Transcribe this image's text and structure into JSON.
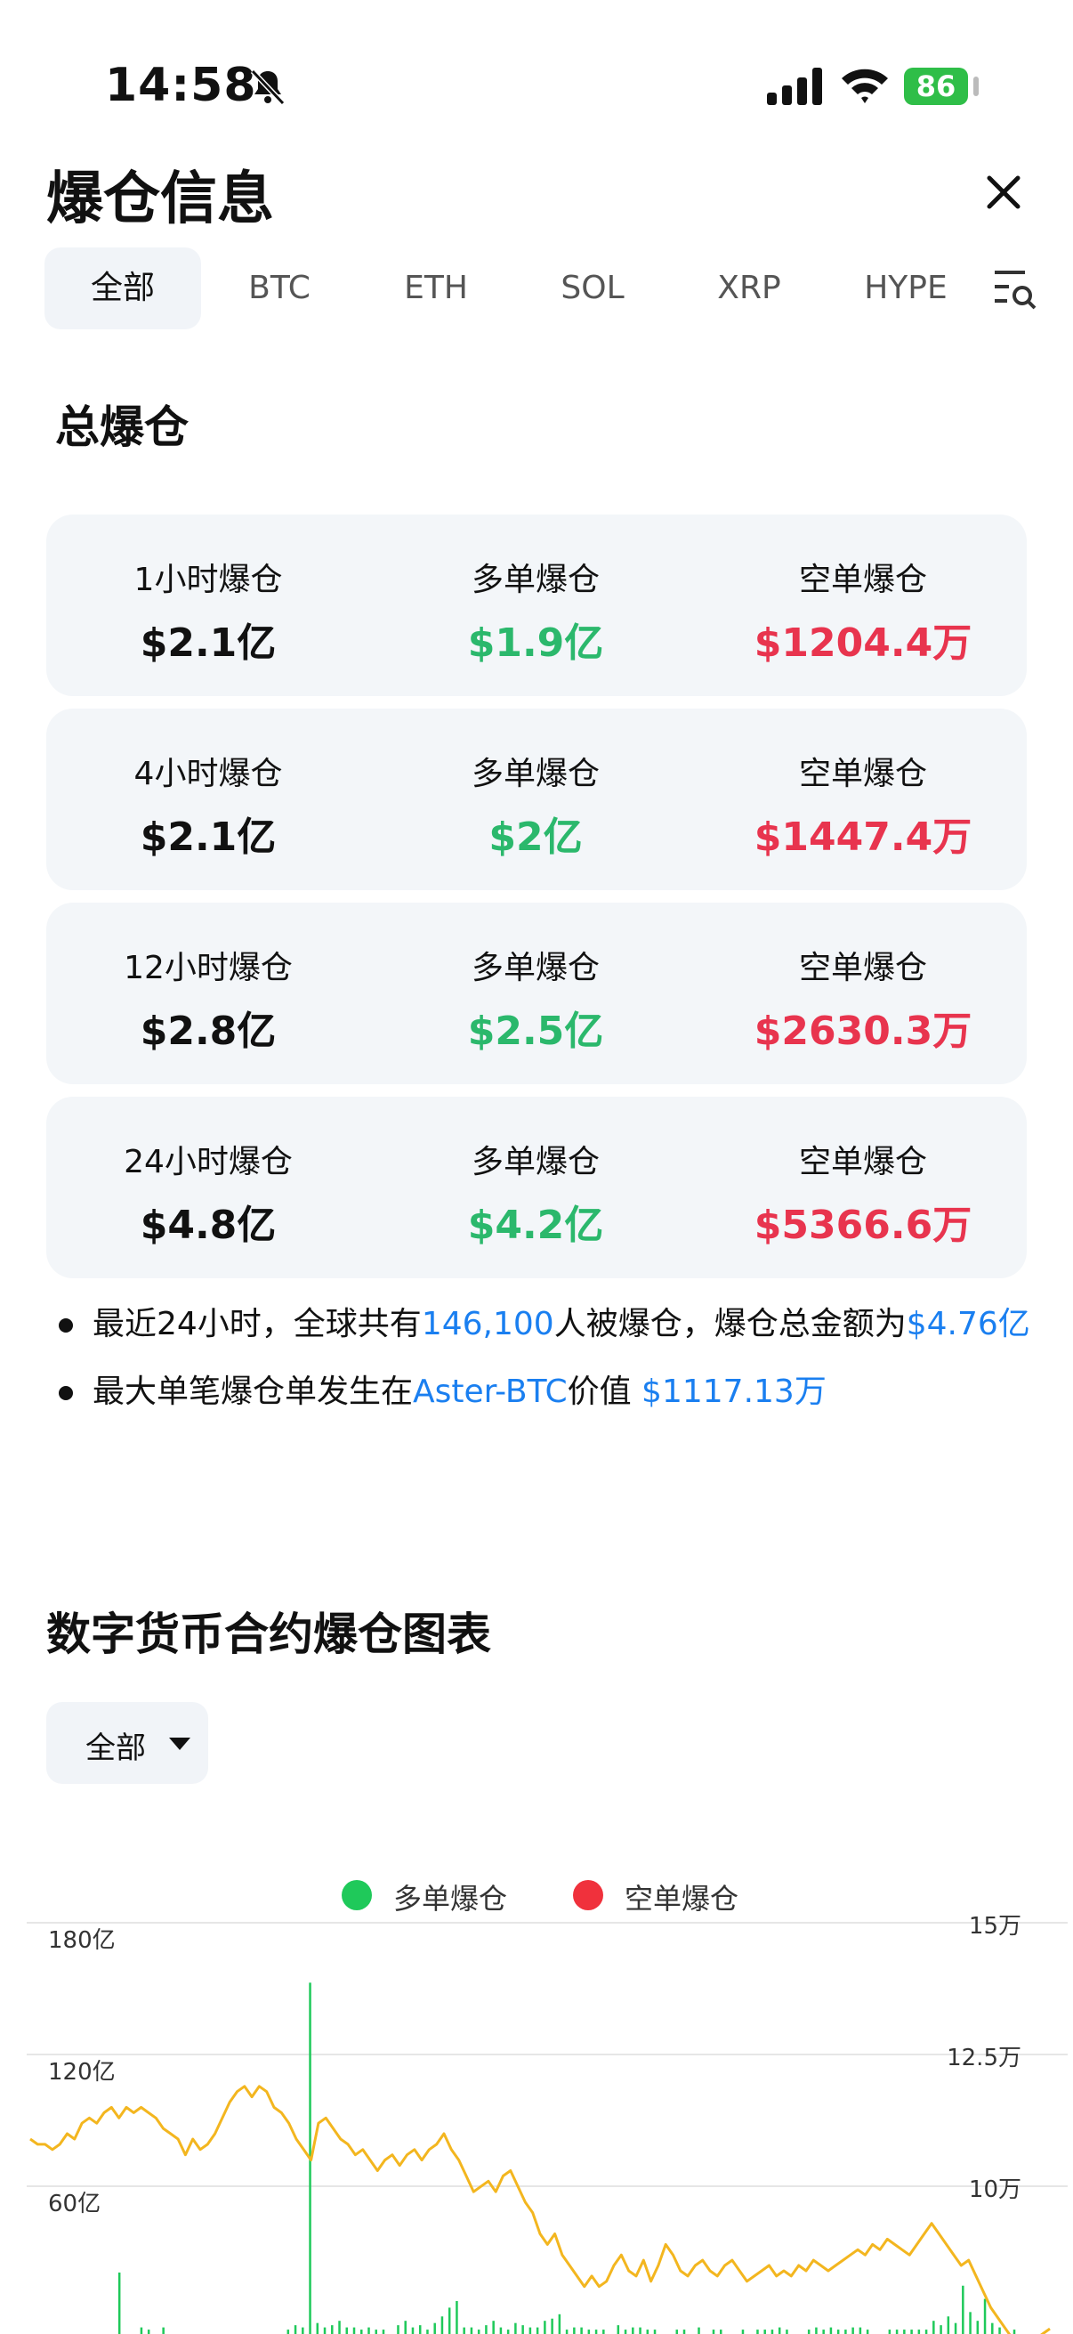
{
  "status_bar": {
    "time": "14:58",
    "battery": "86"
  },
  "header": {
    "title": "爆仓信息"
  },
  "tabs": [
    "全部",
    "BTC",
    "ETH",
    "SOL",
    "XRP",
    "HYPE"
  ],
  "summary": {
    "title": "总爆仓",
    "rows": [
      {
        "period": "1小时爆仓",
        "total": "$2.1亿",
        "long_label": "多单爆仓",
        "long": "$1.9亿",
        "short_label": "空单爆仓",
        "short": "$1204.4万"
      },
      {
        "period": "4小时爆仓",
        "total": "$2.1亿",
        "long_label": "多单爆仓",
        "long": "$2亿",
        "short_label": "空单爆仓",
        "short": "$1447.4万"
      },
      {
        "period": "12小时爆仓",
        "total": "$2.8亿",
        "long_label": "多单爆仓",
        "long": "$2.5亿",
        "short_label": "空单爆仓",
        "short": "$2630.3万"
      },
      {
        "period": "24小时爆仓",
        "total": "$4.8亿",
        "long_label": "多单爆仓",
        "long": "$4.2亿",
        "short_label": "空单爆仓",
        "short": "$5366.6万"
      }
    ]
  },
  "notes": {
    "n1_prefix": "最近24小时，全球共有",
    "n1_people": "146,100",
    "n1_mid": "人被爆仓，爆仓总金额为",
    "n1_amount": "$4.76亿",
    "n2_prefix": "最大单笔爆仓单发生在",
    "n2_pair": "Aster-BTC",
    "n2_mid": "价值 ",
    "n2_amount": "$1117.13万"
  },
  "chart_section": {
    "title": "数字货币合约爆仓图表",
    "filter_value": "全部"
  },
  "chart_data": {
    "type": "bar",
    "legend": [
      {
        "name": "多单爆仓",
        "color": "#1fc95a"
      },
      {
        "name": "空单爆仓",
        "color": "#f0313c"
      }
    ],
    "left_axis": {
      "ticks": [
        "180亿",
        "120亿",
        "60亿"
      ],
      "values": [
        180,
        120,
        60
      ],
      "unit": "亿"
    },
    "right_axis": {
      "ticks": [
        "15万",
        "12.5万",
        "10万"
      ],
      "values": [
        15,
        12.5,
        10
      ],
      "unit": "万"
    },
    "bars_long": [
      0,
      0,
      0,
      0,
      0,
      0,
      0,
      0,
      0,
      0,
      0,
      0,
      28,
      0,
      0,
      3,
      2,
      0,
      3,
      0,
      0,
      0,
      0,
      0,
      0,
      0,
      0,
      0,
      0,
      0,
      0,
      0,
      0,
      0,
      0,
      2,
      4,
      3,
      160,
      5,
      3,
      4,
      6,
      3,
      3,
      2,
      3,
      2,
      2,
      0,
      4,
      6,
      3,
      4,
      2,
      5,
      8,
      12,
      15,
      3,
      3,
      2,
      4,
      6,
      3,
      2,
      5,
      4,
      3,
      3,
      6,
      7,
      9,
      2,
      3,
      3,
      2,
      2,
      2,
      0,
      4,
      2,
      3,
      3,
      2,
      2,
      0,
      0,
      2,
      2,
      0,
      3,
      0,
      2,
      2,
      0,
      0,
      2,
      0,
      2,
      2,
      2,
      3,
      2,
      0,
      0,
      2,
      3,
      2,
      3,
      2,
      2,
      3,
      3,
      2,
      0,
      0,
      2,
      2,
      2,
      2,
      2,
      2,
      6,
      4,
      8,
      5,
      22,
      10,
      6,
      16,
      5,
      3,
      0,
      2,
      0,
      0,
      0,
      0
    ],
    "line_right": [
      11.2,
      11.1,
      11.1,
      11.0,
      11.1,
      11.3,
      11.2,
      11.5,
      11.6,
      11.5,
      11.7,
      11.8,
      11.6,
      11.8,
      11.7,
      11.8,
      11.7,
      11.6,
      11.4,
      11.3,
      11.2,
      10.9,
      11.2,
      11.0,
      11.1,
      11.3,
      11.6,
      11.9,
      12.1,
      12.2,
      12.0,
      12.2,
      12.1,
      11.8,
      11.7,
      11.5,
      11.2,
      11.0,
      10.8,
      11.5,
      11.6,
      11.4,
      11.2,
      11.1,
      10.9,
      11.0,
      10.8,
      10.6,
      10.8,
      10.9,
      10.7,
      10.9,
      11.0,
      10.8,
      11.0,
      11.1,
      11.3,
      11.0,
      10.8,
      10.5,
      10.2,
      10.3,
      10.4,
      10.2,
      10.5,
      10.6,
      10.3,
      10.0,
      9.8,
      9.4,
      9.2,
      9.4,
      9.0,
      8.8,
      8.6,
      8.4,
      8.6,
      8.4,
      8.5,
      8.8,
      9.0,
      8.7,
      8.6,
      8.9,
      8.5,
      8.8,
      9.2,
      9.0,
      8.7,
      8.6,
      8.8,
      8.9,
      8.7,
      8.6,
      8.8,
      8.9,
      8.7,
      8.5,
      8.6,
      8.7,
      8.8,
      8.6,
      8.7,
      8.6,
      8.8,
      8.7,
      8.9,
      8.8,
      8.7,
      8.8,
      8.9,
      9.0,
      9.1,
      9.0,
      9.2,
      9.1,
      9.3,
      9.2,
      9.1,
      9.0,
      9.2,
      9.4,
      9.6,
      9.4,
      9.2,
      9.0,
      8.8,
      8.9,
      8.6,
      8.3,
      8.0,
      7.8,
      7.6,
      7.4,
      7.3,
      7.3,
      7.4,
      7.5,
      7.6
    ]
  }
}
